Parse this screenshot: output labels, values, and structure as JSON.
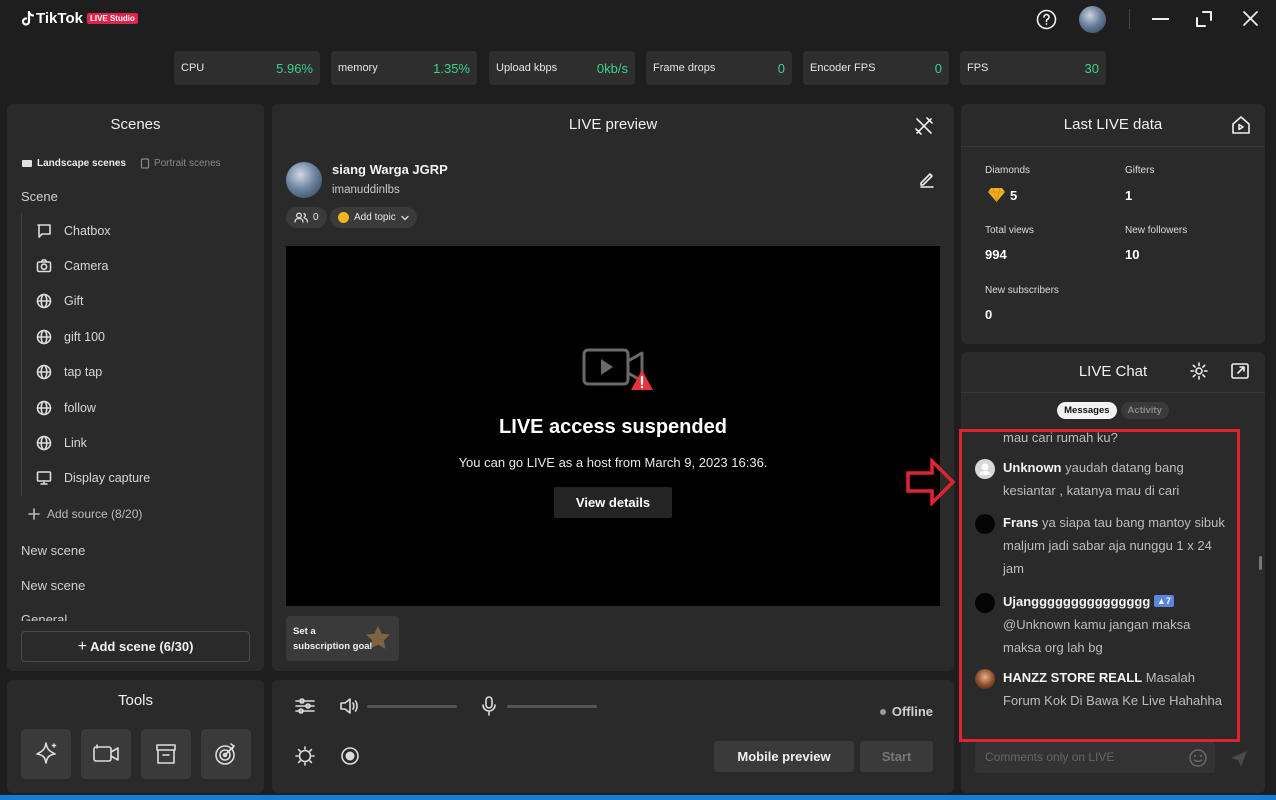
{
  "app": {
    "name": "TikTok",
    "badge": "LIVE Studio"
  },
  "stats": [
    {
      "label": "CPU",
      "value": "5.96%"
    },
    {
      "label": "memory",
      "value": "1.35%"
    },
    {
      "label": "Upload kbps",
      "value": "0kb/s"
    },
    {
      "label": "Frame drops",
      "value": "0"
    },
    {
      "label": "Encoder FPS",
      "value": "0"
    },
    {
      "label": "FPS",
      "value": "30"
    }
  ],
  "scenes": {
    "title": "Scenes",
    "tab_landscape": "Landscape scenes",
    "tab_portrait": "Portrait scenes",
    "current_scene": "Scene",
    "sources": [
      {
        "label": "Chatbox",
        "icon": "chatbox-icon"
      },
      {
        "label": "Camera",
        "icon": "camera-icon"
      },
      {
        "label": "Gift",
        "icon": "globe-icon"
      },
      {
        "label": "gift 100",
        "icon": "globe-icon"
      },
      {
        "label": "tap tap",
        "icon": "globe-icon"
      },
      {
        "label": "follow",
        "icon": "globe-icon"
      },
      {
        "label": "Link",
        "icon": "globe-icon"
      },
      {
        "label": "Display capture",
        "icon": "monitor-icon"
      }
    ],
    "add_source": "Add source (8/20)",
    "other_scenes": [
      "New scene",
      "New scene",
      "General"
    ],
    "add_scene": "Add scene (6/30)"
  },
  "tools": {
    "title": "Tools"
  },
  "preview": {
    "title": "LIVE preview",
    "user_name": "siang Warga JGRP",
    "user_handle": "imanuddinlbs",
    "viewers": "0",
    "add_topic": "Add topic",
    "suspended_title": "LIVE access suspended",
    "suspended_sub": "You can go LIVE as a host from March 9, 2023 16:36.",
    "view_details": "View details",
    "sub_goal_line1": "Set a",
    "sub_goal_line2": "subscription goal"
  },
  "controls": {
    "status": "Offline",
    "mobile_preview": "Mobile preview",
    "start": "Start"
  },
  "last_live": {
    "title": "Last LIVE data",
    "diamonds_label": "Diamonds",
    "diamonds": "5",
    "gifters_label": "Gifters",
    "gifters": "1",
    "views_label": "Total views",
    "views": "994",
    "followers_label": "New followers",
    "followers": "10",
    "subs_label": "New subscribers",
    "subs": "0"
  },
  "chat": {
    "title": "LIVE Chat",
    "tab_messages": "Messages",
    "tab_activity": "Activity",
    "partial_text": "mau cari rumah ku?",
    "messages": [
      {
        "name": "Unknown",
        "text": "yaudah datang bang kesiantar , katanya mau di cari"
      },
      {
        "name": "Frans",
        "text": "ya siapa tau bang mantoy sibuk maljum jadi sabar aja nunggu 1 x 24 jam"
      },
      {
        "name": "Ujanggggggggggggggg",
        "badge": "7",
        "text": "@Unknown kamu jangan maksa maksa org lah bg"
      },
      {
        "name": "HANZZ STORE REALL",
        "text": "Masalah Forum Kok Di Bawa Ke Live Hahahha"
      }
    ],
    "comment_placeholder": "Comments only on LIVE"
  },
  "colors": {
    "accent_green": "#3fcf8e",
    "annotation_red": "#e0242d",
    "brand_pink": "#e0244d"
  }
}
